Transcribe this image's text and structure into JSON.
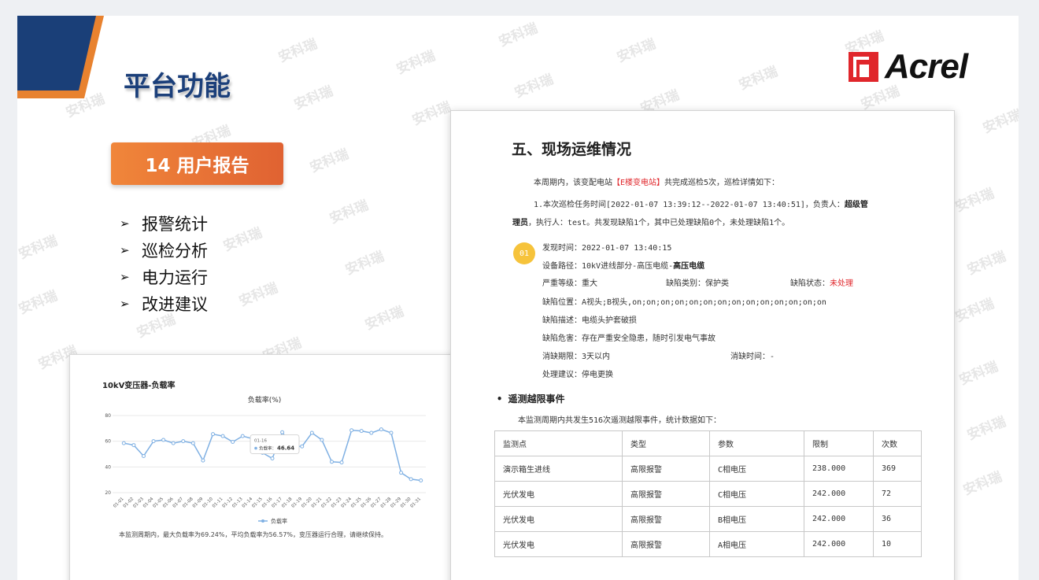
{
  "title": "平台功能",
  "logo": {
    "brand": "Acrel"
  },
  "watermark": "安科瑞",
  "badge": "14 用户报告",
  "features": [
    "报警统计",
    "巡检分析",
    "电力运行",
    "改进建议"
  ],
  "chart_card": {
    "title": "10kV变压器-负载率",
    "summary": "本监测周期内，最大负载率为69.24%，平均负载率为56.57%，变压器运行合理，请继续保持。",
    "tooltip": {
      "date": "01-16",
      "label": "负载率",
      "value": "46.64"
    }
  },
  "chart_data": {
    "type": "line",
    "title": "负载率(%)",
    "categories": [
      "01-01",
      "01-02",
      "01-03",
      "01-04",
      "01-05",
      "01-06",
      "01-07",
      "01-08",
      "01-09",
      "01-10",
      "01-11",
      "01-12",
      "01-13",
      "01-14",
      "01-15",
      "01-16",
      "01-17",
      "01-18",
      "01-19",
      "01-20",
      "01-21",
      "01-22",
      "01-23",
      "01-24",
      "01-25",
      "01-26",
      "01-27",
      "01-28",
      "01-29",
      "01-30",
      "01-31"
    ],
    "series": [
      {
        "name": "负载率",
        "values": [
          58.5,
          57,
          48.5,
          60,
          61,
          58.5,
          60,
          58.5,
          45,
          65.5,
          64,
          59.5,
          64,
          62,
          51,
          46.64,
          67,
          56,
          56,
          66.5,
          61,
          44,
          43.5,
          68.5,
          68,
          66.5,
          69.24,
          66.5,
          35.5,
          30.5,
          29.5
        ]
      }
    ],
    "yticks": [
      20,
      40,
      60,
      80
    ],
    "ylim": [
      20,
      80
    ],
    "grid": true,
    "legend": "bottom",
    "color": "#7fb0e3"
  },
  "report": {
    "heading": "五、现场运维情况",
    "intro_pre": "本周期内，该变配电站",
    "intro_station": "【E楼变电站】",
    "intro_post": "共完成巡检5次，巡检详情如下：",
    "task_line1_pre": "1.本次巡检任务时间[2022-01-07 13:39:12--2022-01-07 13:40:51]，负责人：",
    "task_line1_bold": "超级管",
    "task_line2_bold": "理员",
    "task_line2_post": "，执行人：test。共发现缺陷1个，其中已处理缺陷0个，未处理缺陷1个。",
    "defect": {
      "num": "01",
      "found_time": "发现时间：2022-01-07 13:40:15",
      "path_pre": "设备路径：10kV进线部分-高压电缆-",
      "path_bold": "高压电缆",
      "severity": "严重等级：重大",
      "category": "缺陷类别：保护类",
      "status_label": "缺陷状态：",
      "status_value": "未处理",
      "location": "缺陷位置：A视头;B视头,on;on;on;on;on;on;on;on;on;on;on;on;on;on",
      "description": "缺陷描述：电缆头护套破损",
      "hazard": "缺陷危害：存在严重安全隐患，随时引发电气事故",
      "deadline": "消缺期限：3天以内",
      "fix_time": "消缺时间：-",
      "suggestion": "处理建议：停电更换"
    },
    "section": "• 遥测越限事件",
    "section_intro": "本监测周期内共发生516次遥测越限事件，统计数据如下：",
    "table": {
      "headers": [
        "监测点",
        "类型",
        "参数",
        "限制",
        "次数"
      ],
      "rows": [
        [
          "演示箱生进线",
          "高限报警",
          "C相电压",
          "238.000",
          "369"
        ],
        [
          "光伏发电",
          "高限报警",
          "C相电压",
          "242.000",
          "72"
        ],
        [
          "光伏发电",
          "高限报警",
          "B相电压",
          "242.000",
          "36"
        ],
        [
          "光伏发电",
          "高限报警",
          "A相电压",
          "242.000",
          "10"
        ]
      ]
    }
  }
}
